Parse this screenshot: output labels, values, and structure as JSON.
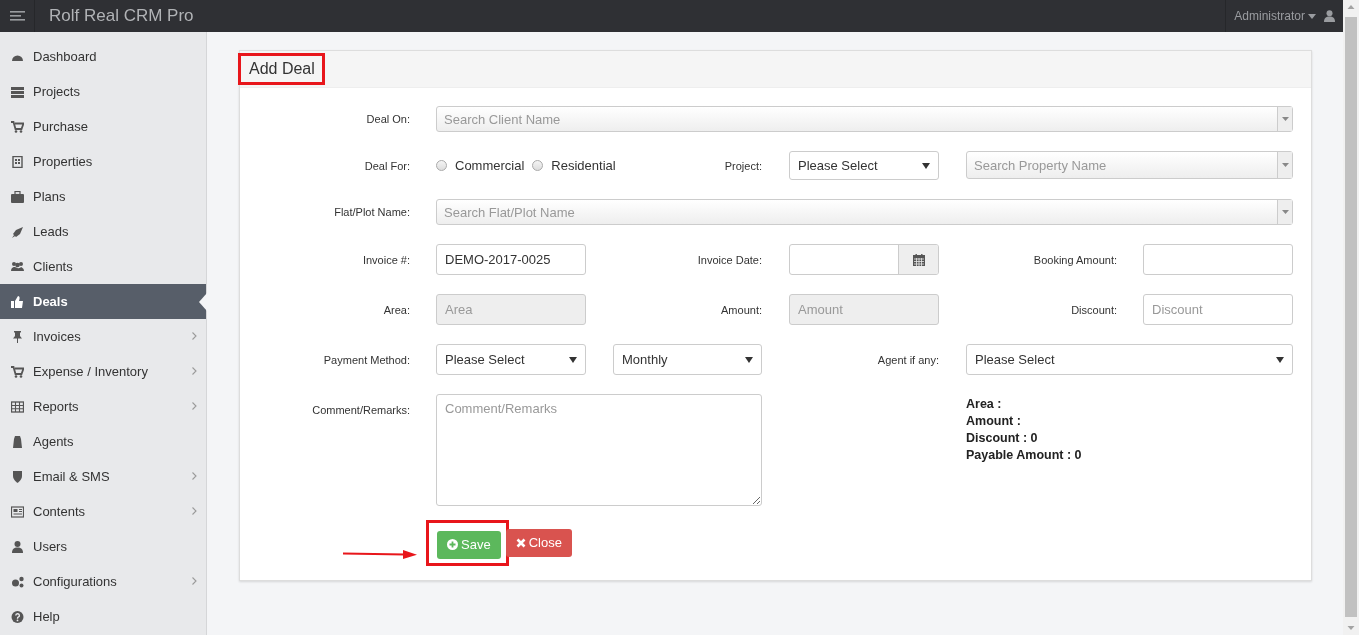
{
  "app": {
    "title": "Rolf Real CRM Pro",
    "user": "Administrator"
  },
  "sidebar": {
    "items": [
      {
        "label": "Dashboard",
        "selected": false,
        "expandable": false
      },
      {
        "label": "Projects",
        "selected": false,
        "expandable": false
      },
      {
        "label": "Purchase",
        "selected": false,
        "expandable": false
      },
      {
        "label": "Properties",
        "selected": false,
        "expandable": false
      },
      {
        "label": "Plans",
        "selected": false,
        "expandable": false
      },
      {
        "label": "Leads",
        "selected": false,
        "expandable": false
      },
      {
        "label": "Clients",
        "selected": false,
        "expandable": false
      },
      {
        "label": "Deals",
        "selected": true,
        "expandable": false
      },
      {
        "label": "Invoices",
        "selected": false,
        "expandable": true
      },
      {
        "label": "Expense / Inventory",
        "selected": false,
        "expandable": true
      },
      {
        "label": "Reports",
        "selected": false,
        "expandable": true
      },
      {
        "label": "Agents",
        "selected": false,
        "expandable": false
      },
      {
        "label": "Email & SMS",
        "selected": false,
        "expandable": true
      },
      {
        "label": "Contents",
        "selected": false,
        "expandable": true
      },
      {
        "label": "Users",
        "selected": false,
        "expandable": false
      },
      {
        "label": "Configurations",
        "selected": false,
        "expandable": true
      },
      {
        "label": "Help",
        "selected": false,
        "expandable": false
      }
    ]
  },
  "form": {
    "title": "Add Deal",
    "deal_on": {
      "label": "Deal On:",
      "placeholder": "Search Client Name"
    },
    "deal_for": {
      "label": "Deal For:",
      "options": [
        {
          "label": "Commercial",
          "selected": false
        },
        {
          "label": "Residential",
          "selected": false
        }
      ]
    },
    "project": {
      "label": "Project:",
      "value": "Please Select"
    },
    "property": {
      "placeholder": "Search Property Name"
    },
    "flat": {
      "label": "Flat/Plot Name:",
      "placeholder": "Search Flat/Plot Name"
    },
    "invoice_no": {
      "label": "Invoice #:",
      "value": "DEMO-2017-0025"
    },
    "invoice_date": {
      "label": "Invoice Date:"
    },
    "booking_amount": {
      "label": "Booking Amount:"
    },
    "area": {
      "label": "Area:",
      "placeholder": "Area",
      "disabled": true
    },
    "amount": {
      "label": "Amount:",
      "placeholder": "Amount",
      "disabled": true
    },
    "discount": {
      "label": "Discount:",
      "placeholder": "Discount",
      "disabled": false
    },
    "payment_method": {
      "label": "Payment Method:",
      "value": "Please Select"
    },
    "frequency": {
      "value": "Monthly"
    },
    "agent": {
      "label": "Agent if any:",
      "value": "Please Select"
    },
    "comment": {
      "label": "Comment/Remarks:",
      "placeholder": "Comment/Remarks"
    },
    "summary": [
      "Area :",
      "Amount :",
      "Discount : 0",
      "Payable Amount : 0"
    ],
    "buttons": [
      {
        "label": "Save",
        "kind": "save"
      },
      {
        "label": "Close",
        "kind": "close"
      }
    ]
  }
}
